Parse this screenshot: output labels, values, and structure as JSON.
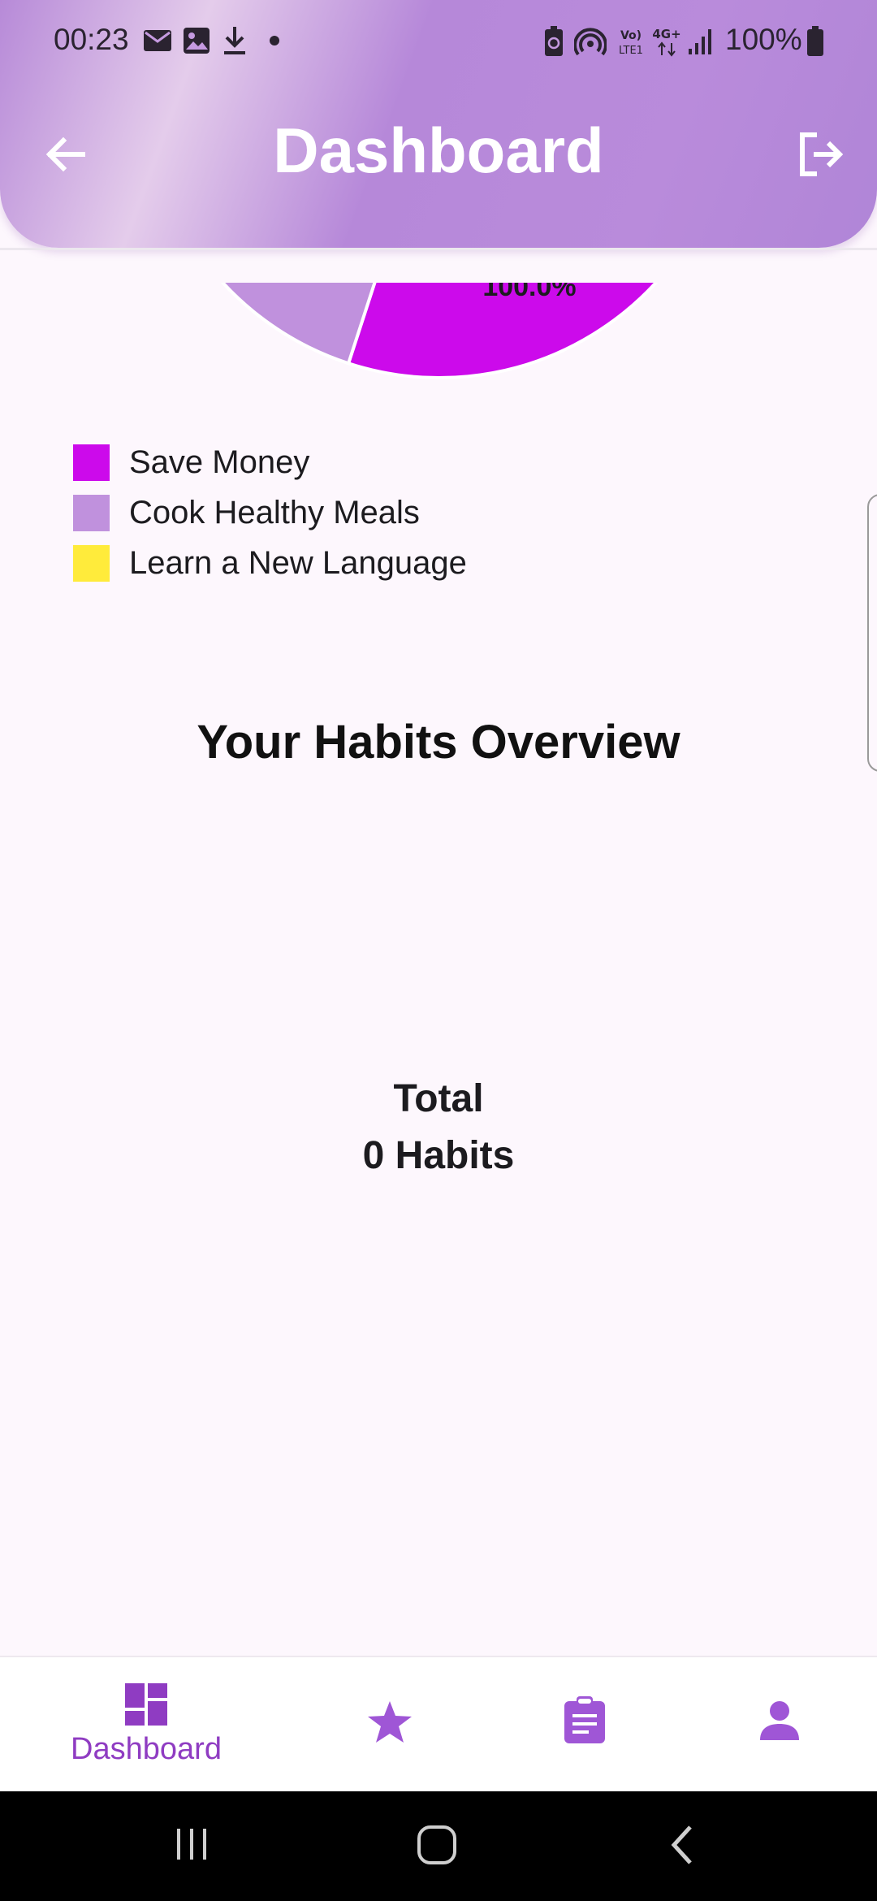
{
  "status_bar": {
    "time": "00:23",
    "battery": "100%",
    "icons": [
      "mail-icon",
      "image-icon",
      "download-icon",
      "dot-icon",
      "battery-saver-icon",
      "hotspot-icon",
      "volte-icon",
      "4g-icon",
      "signal-icon",
      "battery-icon"
    ]
  },
  "header": {
    "title": "Dashboard",
    "back_icon": "arrow-left-icon",
    "logout_icon": "logout-icon",
    "gradient_colors": [
      "#b78ad8",
      "#e4cceb",
      "#b688d9"
    ]
  },
  "chart_data": {
    "type": "pie",
    "visible_label": "100.0%",
    "series": [
      {
        "name": "Save Money",
        "color": "#cc0aeb"
      },
      {
        "name": "Cook Healthy Meals",
        "color": "#c091dd"
      },
      {
        "name": "Learn a New Language",
        "color": "#ffeb3b"
      }
    ],
    "legend_placement": "bottom-left"
  },
  "legend": {
    "items": [
      {
        "label": "Save Money",
        "color": "#cc0aeb"
      },
      {
        "label": "Cook Healthy Meals",
        "color": "#c091dd"
      },
      {
        "label": "Learn a New Language",
        "color": "#ffeb3b"
      }
    ]
  },
  "overview": {
    "title": "Your Habits Overview",
    "total_label": "Total",
    "total_value": "0 Habits"
  },
  "bottom_nav": {
    "items": [
      {
        "label": "Dashboard",
        "icon": "dashboard-icon",
        "active": true
      },
      {
        "label": "",
        "icon": "star-icon",
        "active": false
      },
      {
        "label": "",
        "icon": "clipboard-icon",
        "active": false
      },
      {
        "label": "",
        "icon": "person-icon",
        "active": false
      }
    ],
    "accent": "#8f3cc2"
  },
  "system_nav": {
    "icons": [
      "recents-icon",
      "home-icon",
      "back-icon"
    ]
  }
}
